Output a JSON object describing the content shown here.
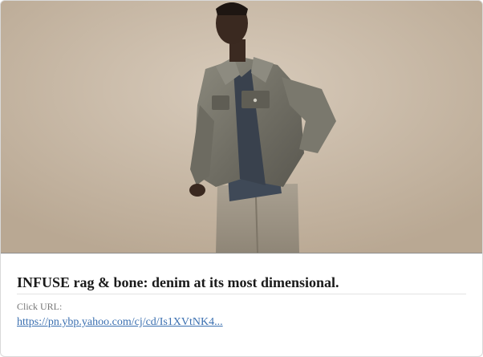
{
  "ad": {
    "image_description": "model-in-denim-jacket-photo",
    "title": "INFUSE rag & bone: denim at its most dimensional.",
    "click_url_label": "Click URL:",
    "click_url": "https://pn.ybp.yahoo.com/cj/cd/Is1XVtNK4..."
  },
  "colors": {
    "background": "#ffffff",
    "wall": "#c6b7a4",
    "link": "#3a6fb0",
    "title": "#1a1a1a",
    "label": "#777777"
  }
}
